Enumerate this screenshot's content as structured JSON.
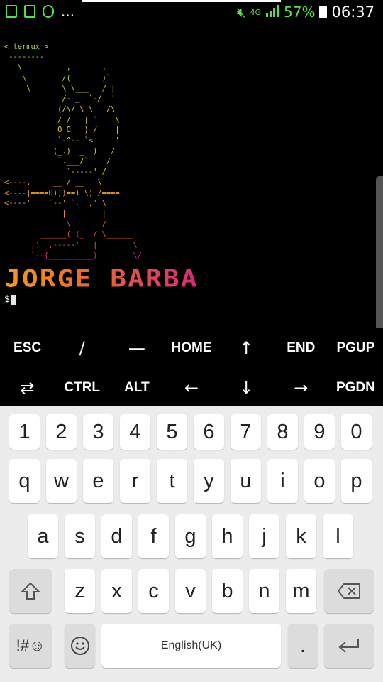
{
  "status_bar": {
    "more": "...",
    "network": "4G",
    "battery_percent": "57%",
    "time": "06:37",
    "colors": {
      "accent": "#53e04a"
    },
    "icons": [
      "gallery-icon",
      "sim-icon",
      "usb-icon",
      "mute-icon",
      "signal-icon",
      "battery-icon"
    ]
  },
  "terminal": {
    "speech_bubble": [
      " ________",
      "< termux >",
      " --------"
    ],
    "art_lines": [
      "   \\          ,       ,",
      "    \\        /(       )`",
      "     \\       \\ \\___   / |",
      "             /- _  `-/  '",
      "            (/\\/ \\ \\   /\\",
      "            / /   | `    \\",
      "            O O   ) /    |",
      "            `-^--'`<     '",
      "           (_.)  _  )   /",
      "            `.___/`    /",
      "              `-----' /",
      "<----.     __ / __   \\",
      "<----|====O)))==) \\) /====",
      "<----'    `--' `.__,' \\",
      "             |        |",
      "              \\       /",
      "        ______( (_  / \\______",
      "      ,'  ,-----'   |        \\",
      "      `--{__________)        \\/"
    ],
    "banner": "JORGE BARBA",
    "prompt": "$"
  },
  "extra_keys": {
    "row1": [
      "ESC",
      "/",
      "—",
      "HOME",
      "↑",
      "END",
      "PGUP"
    ],
    "row2": [
      "⇄",
      "CTRL",
      "ALT",
      "←",
      "↓",
      "→",
      "PGDN"
    ]
  },
  "keyboard": {
    "numbers": [
      "1",
      "2",
      "3",
      "4",
      "5",
      "6",
      "7",
      "8",
      "9",
      "0"
    ],
    "row_q": [
      "q",
      "w",
      "e",
      "r",
      "t",
      "y",
      "u",
      "i",
      "o",
      "p"
    ],
    "row_a": [
      "a",
      "s",
      "d",
      "f",
      "g",
      "h",
      "j",
      "k",
      "l"
    ],
    "row_z": [
      "z",
      "x",
      "c",
      "v",
      "b",
      "n",
      "m"
    ],
    "symbols_label": "!#☺",
    "space_label": "English(UK)",
    "period": "."
  }
}
